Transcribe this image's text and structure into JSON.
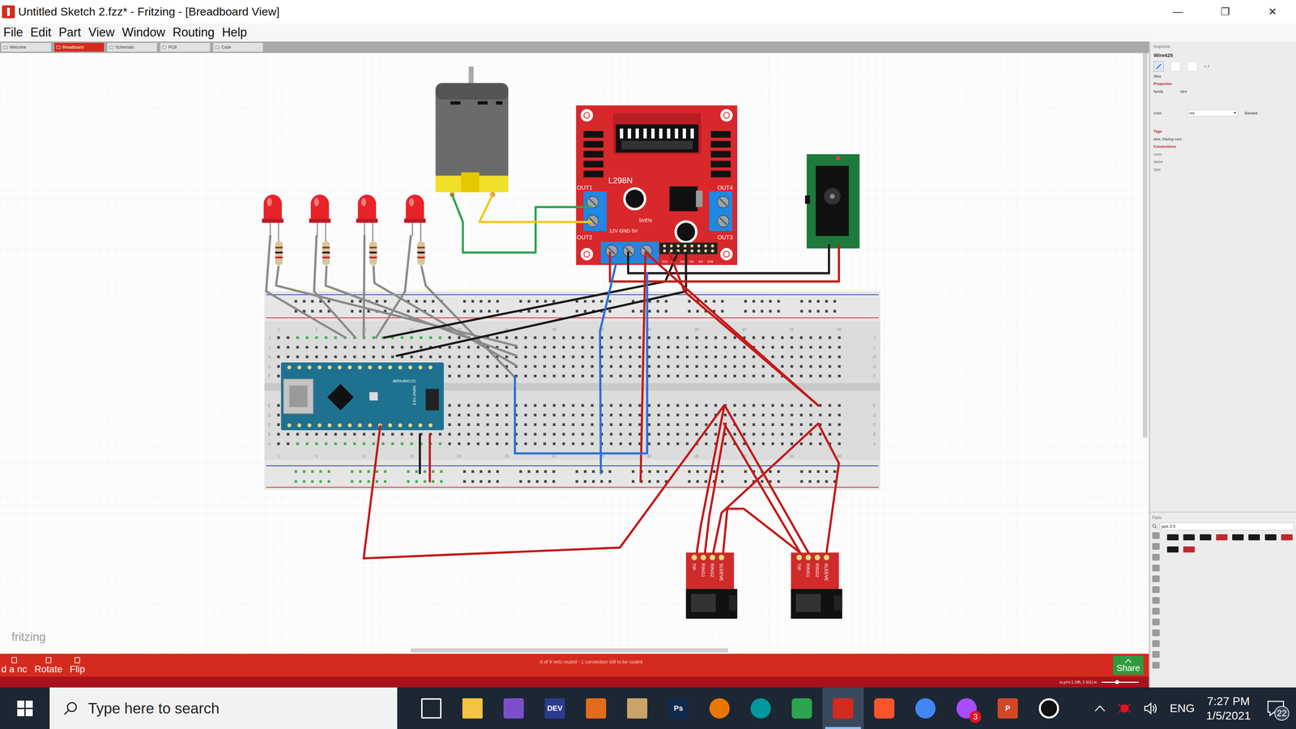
{
  "window": {
    "title": "Untitled Sketch 2.fzz* - Fritzing - [Breadboard View]",
    "controls": [
      "—",
      "❐",
      "✕"
    ]
  },
  "menu": [
    "File",
    "Edit",
    "Part",
    "View",
    "Window",
    "Routing",
    "Help"
  ],
  "tabs": [
    {
      "label": "Welcome",
      "selected": false
    },
    {
      "label": "Breadboard",
      "selected": true
    },
    {
      "label": "Schematic",
      "selected": false
    },
    {
      "label": "PCB",
      "selected": false
    },
    {
      "label": "Code",
      "selected": false
    }
  ],
  "canvas": {
    "watermark": "fritzing",
    "driver": {
      "name": "L298N",
      "outputs": [
        "OUT1",
        "OUT2",
        "OUT4",
        "OUT3"
      ],
      "power": "12V GND 5V",
      "jumper": "5VEN",
      "inputs": [
        "ENA",
        "IN1",
        "IN2",
        "IN3",
        "IN4",
        "ENB"
      ]
    },
    "arduino": {
      "brand": "ARDUINO.CC",
      "model": "NANO V3.0"
    },
    "breadboard": {
      "columns": [
        "1",
        "5",
        "10",
        "15",
        "20",
        "25",
        "30",
        "35",
        "40",
        "45",
        "50",
        "55",
        "60"
      ],
      "rows": [
        "J",
        "I",
        "H",
        "G",
        "F",
        "E",
        "D",
        "C",
        "B",
        "A"
      ]
    },
    "jacks": [
      {
        "pins": [
          "TIP",
          "RING1",
          "RING2",
          "SLEEVE"
        ]
      },
      {
        "pins": [
          "TIP",
          "RING1",
          "RING2",
          "SLEEVE"
        ]
      }
    ]
  },
  "inspector": {
    "title": "Inspector",
    "part": "Wire425",
    "version": "v. 4",
    "kind": "Wire",
    "properties": "Properties",
    "family_label": "family",
    "family": "wire",
    "color_label": "color",
    "color_value": "red",
    "banded": "Banded",
    "tags_title": "Tags",
    "tags": "wire, fritzing core",
    "connections_title": "Connections",
    "fields": [
      "conn.",
      "name",
      "type"
    ]
  },
  "parts": {
    "title": "Parts",
    "search": "jack 3.5",
    "results": [
      {
        "color": "#1a1a1a"
      },
      {
        "color": "#1a1a1a"
      },
      {
        "color": "#1a1a1a"
      },
      {
        "color": "#c0282d"
      },
      {
        "color": "#1a1a1a"
      },
      {
        "color": "#1a1a1a"
      },
      {
        "color": "#1a1a1a"
      },
      {
        "color": "#c0282d"
      },
      {
        "color": "#1a1a1a"
      },
      {
        "color": "#c0282d"
      }
    ]
  },
  "toolbar": {
    "buttons": [
      "d a nc",
      "Rotate",
      "Flip"
    ],
    "status": "8 of 9 nets routed - 1 connection still to be routed",
    "share": "Share",
    "coords": "(x,y)=(-1.195, 2.311) in"
  },
  "taskbar": {
    "search": "Type here to search",
    "language": "ENG",
    "time": "7:27 PM",
    "date": "1/5/2021",
    "notifications": "22",
    "apps": [
      {
        "active": false
      },
      {
        "active": false
      },
      {
        "active": false
      },
      {
        "active": false,
        "label": "DEV"
      },
      {
        "active": false
      },
      {
        "active": false
      },
      {
        "active": false,
        "label": "Ps"
      },
      {
        "active": false
      },
      {
        "active": false
      },
      {
        "active": false
      },
      {
        "active": true
      },
      {
        "active": false
      },
      {
        "active": false
      },
      {
        "active": false,
        "badge": "3"
      },
      {
        "active": false,
        "label": "P"
      },
      {
        "active": false
      }
    ]
  }
}
